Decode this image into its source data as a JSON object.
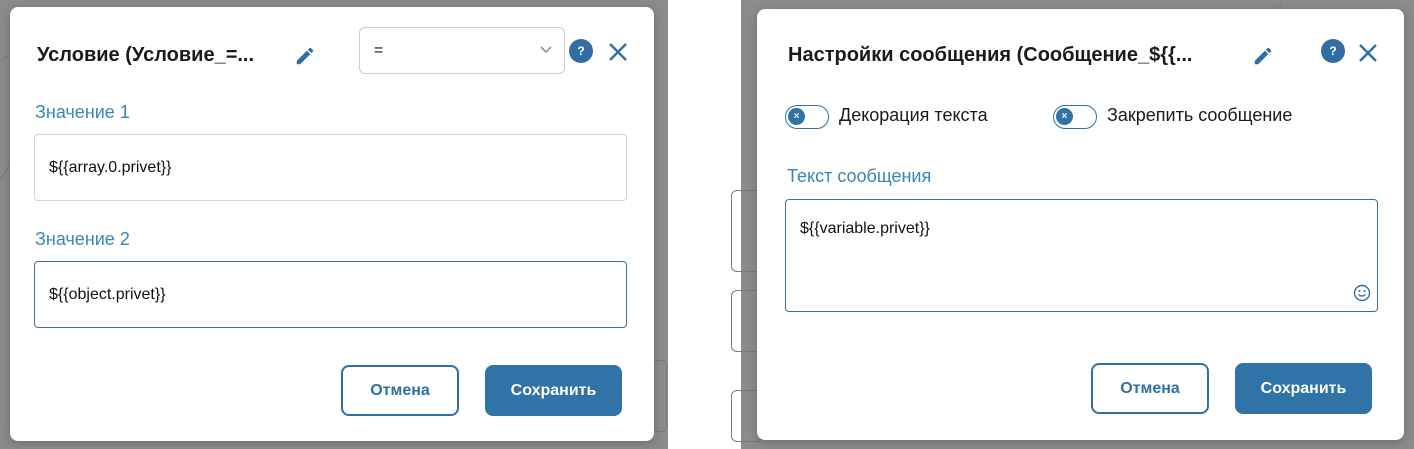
{
  "condition_dialog": {
    "title": "Условие (Условие_=...",
    "operator": "=",
    "value1_label": "Значение 1",
    "value1": "${{array.0.privet}}",
    "value2_label": "Значение 2",
    "value2": "${{object.privet}}",
    "cancel_label": "Отмена",
    "save_label": "Сохранить",
    "help_glyph": "?"
  },
  "message_dialog": {
    "title": "Настройки сообщения (Сообщение_${{...",
    "toggle1_label": "Декорация текста",
    "toggle1_on": false,
    "toggle2_label": "Закрепить сообщение",
    "toggle2_on": false,
    "text_label": "Текст сообщения",
    "text_value": "${{variable.privet}}",
    "cancel_label": "Отмена",
    "save_label": "Сохранить",
    "help_glyph": "?"
  },
  "colors": {
    "accent": "#2f6fa3",
    "label": "#3a86b4",
    "backdrop": "#8c8c8c"
  },
  "icons": [
    "pencil-icon",
    "help-icon",
    "close-icon",
    "chevron-down-icon",
    "emoji-icon",
    "toggle-off-icon"
  ]
}
